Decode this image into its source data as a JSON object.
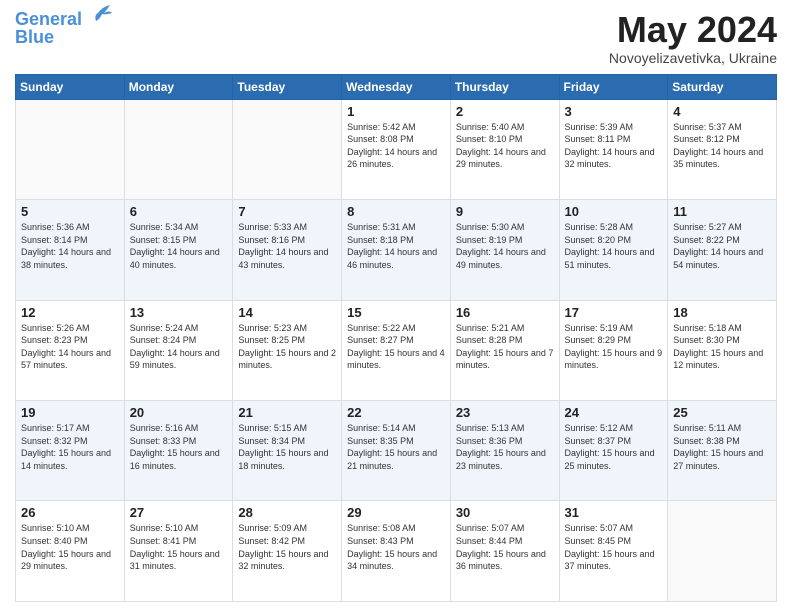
{
  "header": {
    "logo_line1": "General",
    "logo_line2": "Blue",
    "month": "May 2024",
    "location": "Novoyelizavetivka, Ukraine"
  },
  "days_of_week": [
    "Sunday",
    "Monday",
    "Tuesday",
    "Wednesday",
    "Thursday",
    "Friday",
    "Saturday"
  ],
  "weeks": [
    [
      {
        "day": "",
        "info": ""
      },
      {
        "day": "",
        "info": ""
      },
      {
        "day": "",
        "info": ""
      },
      {
        "day": "1",
        "info": "Sunrise: 5:42 AM\nSunset: 8:08 PM\nDaylight: 14 hours and 26 minutes."
      },
      {
        "day": "2",
        "info": "Sunrise: 5:40 AM\nSunset: 8:10 PM\nDaylight: 14 hours and 29 minutes."
      },
      {
        "day": "3",
        "info": "Sunrise: 5:39 AM\nSunset: 8:11 PM\nDaylight: 14 hours and 32 minutes."
      },
      {
        "day": "4",
        "info": "Sunrise: 5:37 AM\nSunset: 8:12 PM\nDaylight: 14 hours and 35 minutes."
      }
    ],
    [
      {
        "day": "5",
        "info": "Sunrise: 5:36 AM\nSunset: 8:14 PM\nDaylight: 14 hours and 38 minutes."
      },
      {
        "day": "6",
        "info": "Sunrise: 5:34 AM\nSunset: 8:15 PM\nDaylight: 14 hours and 40 minutes."
      },
      {
        "day": "7",
        "info": "Sunrise: 5:33 AM\nSunset: 8:16 PM\nDaylight: 14 hours and 43 minutes."
      },
      {
        "day": "8",
        "info": "Sunrise: 5:31 AM\nSunset: 8:18 PM\nDaylight: 14 hours and 46 minutes."
      },
      {
        "day": "9",
        "info": "Sunrise: 5:30 AM\nSunset: 8:19 PM\nDaylight: 14 hours and 49 minutes."
      },
      {
        "day": "10",
        "info": "Sunrise: 5:28 AM\nSunset: 8:20 PM\nDaylight: 14 hours and 51 minutes."
      },
      {
        "day": "11",
        "info": "Sunrise: 5:27 AM\nSunset: 8:22 PM\nDaylight: 14 hours and 54 minutes."
      }
    ],
    [
      {
        "day": "12",
        "info": "Sunrise: 5:26 AM\nSunset: 8:23 PM\nDaylight: 14 hours and 57 minutes."
      },
      {
        "day": "13",
        "info": "Sunrise: 5:24 AM\nSunset: 8:24 PM\nDaylight: 14 hours and 59 minutes."
      },
      {
        "day": "14",
        "info": "Sunrise: 5:23 AM\nSunset: 8:25 PM\nDaylight: 15 hours and 2 minutes."
      },
      {
        "day": "15",
        "info": "Sunrise: 5:22 AM\nSunset: 8:27 PM\nDaylight: 15 hours and 4 minutes."
      },
      {
        "day": "16",
        "info": "Sunrise: 5:21 AM\nSunset: 8:28 PM\nDaylight: 15 hours and 7 minutes."
      },
      {
        "day": "17",
        "info": "Sunrise: 5:19 AM\nSunset: 8:29 PM\nDaylight: 15 hours and 9 minutes."
      },
      {
        "day": "18",
        "info": "Sunrise: 5:18 AM\nSunset: 8:30 PM\nDaylight: 15 hours and 12 minutes."
      }
    ],
    [
      {
        "day": "19",
        "info": "Sunrise: 5:17 AM\nSunset: 8:32 PM\nDaylight: 15 hours and 14 minutes."
      },
      {
        "day": "20",
        "info": "Sunrise: 5:16 AM\nSunset: 8:33 PM\nDaylight: 15 hours and 16 minutes."
      },
      {
        "day": "21",
        "info": "Sunrise: 5:15 AM\nSunset: 8:34 PM\nDaylight: 15 hours and 18 minutes."
      },
      {
        "day": "22",
        "info": "Sunrise: 5:14 AM\nSunset: 8:35 PM\nDaylight: 15 hours and 21 minutes."
      },
      {
        "day": "23",
        "info": "Sunrise: 5:13 AM\nSunset: 8:36 PM\nDaylight: 15 hours and 23 minutes."
      },
      {
        "day": "24",
        "info": "Sunrise: 5:12 AM\nSunset: 8:37 PM\nDaylight: 15 hours and 25 minutes."
      },
      {
        "day": "25",
        "info": "Sunrise: 5:11 AM\nSunset: 8:38 PM\nDaylight: 15 hours and 27 minutes."
      }
    ],
    [
      {
        "day": "26",
        "info": "Sunrise: 5:10 AM\nSunset: 8:40 PM\nDaylight: 15 hours and 29 minutes."
      },
      {
        "day": "27",
        "info": "Sunrise: 5:10 AM\nSunset: 8:41 PM\nDaylight: 15 hours and 31 minutes."
      },
      {
        "day": "28",
        "info": "Sunrise: 5:09 AM\nSunset: 8:42 PM\nDaylight: 15 hours and 32 minutes."
      },
      {
        "day": "29",
        "info": "Sunrise: 5:08 AM\nSunset: 8:43 PM\nDaylight: 15 hours and 34 minutes."
      },
      {
        "day": "30",
        "info": "Sunrise: 5:07 AM\nSunset: 8:44 PM\nDaylight: 15 hours and 36 minutes."
      },
      {
        "day": "31",
        "info": "Sunrise: 5:07 AM\nSunset: 8:45 PM\nDaylight: 15 hours and 37 minutes."
      },
      {
        "day": "",
        "info": ""
      }
    ]
  ]
}
